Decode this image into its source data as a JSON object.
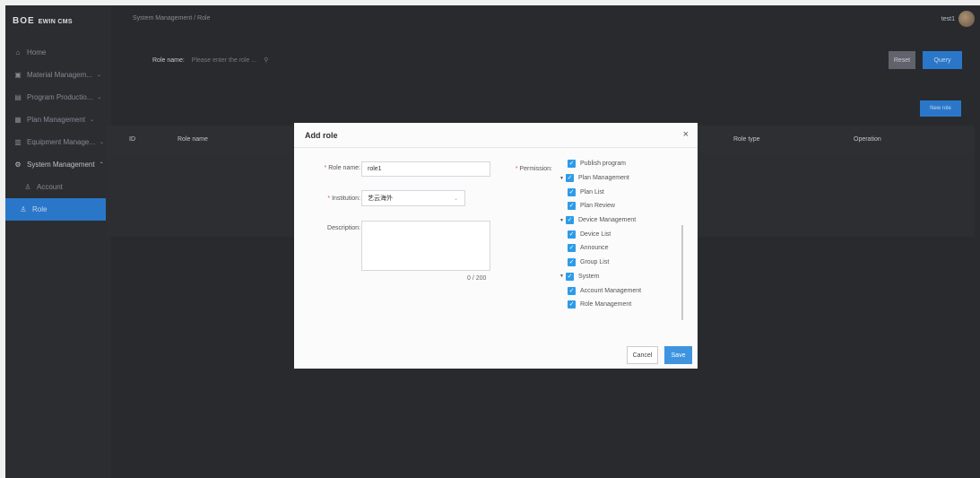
{
  "app": {
    "logo_brand": "BOE",
    "logo_sys": "EWIN CMS",
    "breadcrumb": "System Management  /  Role",
    "user_name": "test1"
  },
  "sidebar": {
    "items": [
      {
        "icon": "home-icon",
        "glyph": "⌂",
        "label": "Home",
        "chevron": ""
      },
      {
        "icon": "image-icon",
        "glyph": "▣",
        "label": "Material Managem...",
        "chevron": "⌄"
      },
      {
        "icon": "document-icon",
        "glyph": "▤",
        "label": "Program Productio...",
        "chevron": "⌄"
      },
      {
        "icon": "calendar-icon",
        "glyph": "▦",
        "label": "Plan Management",
        "chevron": "⌄"
      },
      {
        "icon": "device-icon",
        "glyph": "▥",
        "label": "Equipment Manage...",
        "chevron": "⌄"
      },
      {
        "icon": "settings-icon",
        "glyph": "⚙",
        "label": "System Management",
        "chevron": "⌃"
      }
    ],
    "sub_items": [
      {
        "icon": "user-icon",
        "glyph": "♙",
        "label": "Account"
      },
      {
        "icon": "role-icon",
        "glyph": "♙",
        "label": "Role"
      }
    ]
  },
  "search": {
    "label": "Role name:",
    "placeholder": "Please enter the role ...",
    "reset_label": "Reset",
    "query_label": "Query",
    "new_label": "New role"
  },
  "table": {
    "columns": [
      "ID",
      "Role name",
      "Role type",
      "Operation"
    ]
  },
  "modal": {
    "title": "Add role",
    "close": "×",
    "role_name_label": "Role name:",
    "role_name_value": "role1",
    "institution_label": "Institution:",
    "institution_value": "艺云海外",
    "description_label": "Description:",
    "description_value": "",
    "counter": "0 / 200",
    "permission_label": "Permission:",
    "permissions": [
      {
        "label": "Publish program",
        "level": 1,
        "caret": false
      },
      {
        "label": "Plan Management",
        "level": 0,
        "caret": true
      },
      {
        "label": "Plan List",
        "level": 1,
        "caret": false
      },
      {
        "label": "Plan Review",
        "level": 1,
        "caret": false
      },
      {
        "label": "Device Management",
        "level": 0,
        "caret": true
      },
      {
        "label": "Device List",
        "level": 1,
        "caret": false
      },
      {
        "label": "Announce",
        "level": 1,
        "caret": false
      },
      {
        "label": "Group List",
        "level": 1,
        "caret": false
      },
      {
        "label": "System",
        "level": 0,
        "caret": true
      },
      {
        "label": "Account Management",
        "level": 1,
        "caret": false
      },
      {
        "label": "Role Management",
        "level": 1,
        "caret": false
      }
    ],
    "cancel_label": "Cancel",
    "save_label": "Save"
  },
  "colors": {
    "accent": "#2d7fd6",
    "checkbox": "#2f9be8",
    "sidebar_bg": "#2e3035",
    "content_bg": "#2b2d31"
  }
}
